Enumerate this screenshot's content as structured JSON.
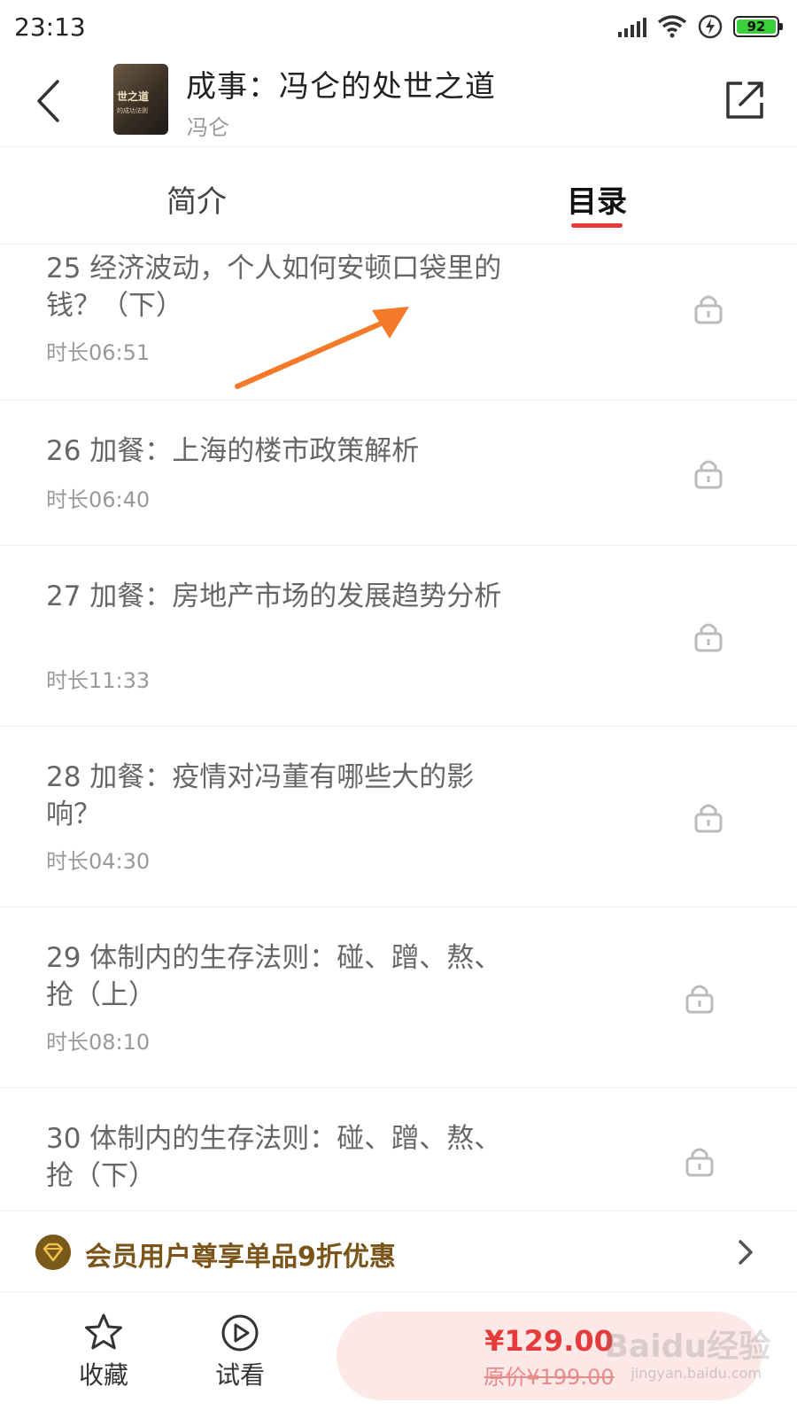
{
  "status_bar": {
    "time": "23:13",
    "battery": "92",
    "battery_color": "#3ccf3c"
  },
  "header": {
    "cover_text": "世之道",
    "cover_subtext": "的成功法则",
    "title": "成事：冯仑的处世之道",
    "author": "冯仑",
    "back_icon": "back-chevron-icon",
    "share_icon": "share-icon"
  },
  "tabs": [
    {
      "label": "简介",
      "active": false
    },
    {
      "label": "目录",
      "active": true
    }
  ],
  "accent_color": "#e63b3b",
  "catalog": [
    {
      "title": "25 经济波动，个人如何安顿口袋里的钱？（下）",
      "duration": "时长06:51",
      "locked": true
    },
    {
      "title": "26 加餐：上海的楼市政策解析",
      "duration": "时长06:40",
      "locked": true
    },
    {
      "title": "27 加餐：房地产市场的发展趋势分析",
      "duration": "时长11:33",
      "locked": true
    },
    {
      "title": "28 加餐：疫情对冯董有哪些大的影响？",
      "duration": "时长04:30",
      "locked": true
    },
    {
      "title": "29 体制内的生存法则：碰、蹭、熬、抢（上）",
      "duration": "时长08:10",
      "locked": true
    },
    {
      "title": "30 体制内的生存法则：碰、蹭、熬、抢（下）",
      "duration": "",
      "locked": true
    }
  ],
  "member_banner": {
    "text": "会员用户尊享单品9折优惠",
    "color": "#7a5418"
  },
  "bottom_bar": {
    "favorite_label": "收藏",
    "trial_label": "试看",
    "price": "¥129.00",
    "original_price": "原价¥199.00"
  },
  "watermark": {
    "text": "Baidu经验",
    "subtext": "jingyan.baidu.com"
  }
}
